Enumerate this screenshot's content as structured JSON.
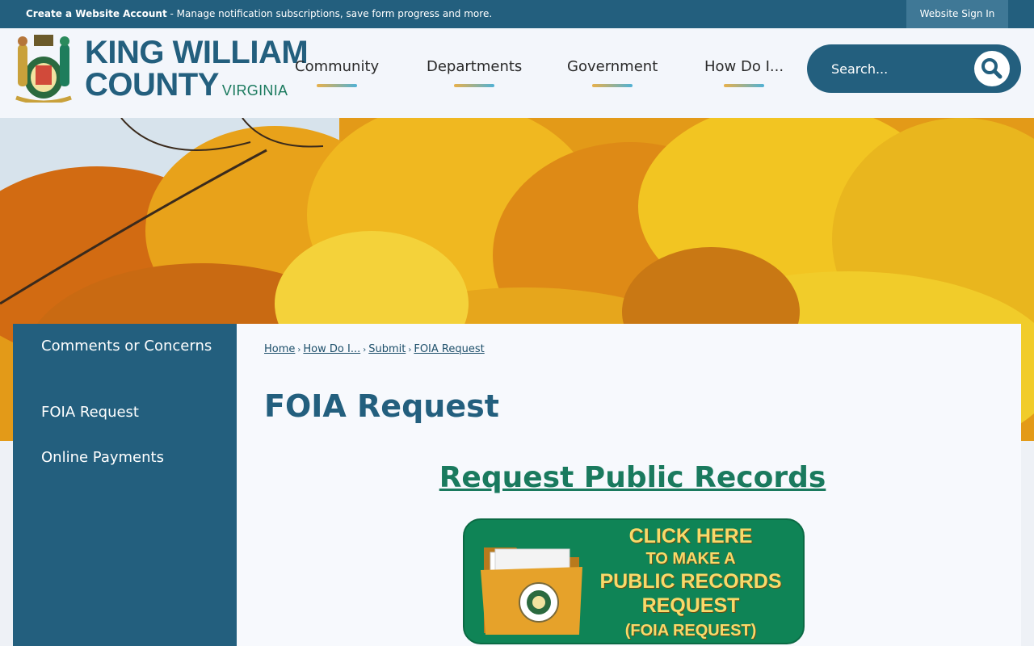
{
  "topbar": {
    "create_account": "Create a Website Account",
    "create_account_desc": " - Manage notification subscriptions, save form progress and more.",
    "sign_in": "Website Sign In"
  },
  "logo": {
    "line1": "KING WILLIAM",
    "line2": "COUNTY",
    "state": "VIRGINIA"
  },
  "nav": {
    "items": [
      {
        "label": "Community"
      },
      {
        "label": "Departments"
      },
      {
        "label": "Government"
      },
      {
        "label": "How Do I..."
      }
    ]
  },
  "search": {
    "placeholder": "Search..."
  },
  "sidebar": {
    "items": [
      {
        "label": "Comments or Concerns"
      },
      {
        "label": "FOIA Request"
      },
      {
        "label": "Online Payments"
      }
    ]
  },
  "breadcrumb": {
    "items": [
      "Home",
      "How Do I...",
      "Submit",
      "FOIA Request"
    ]
  },
  "main": {
    "title": "FOIA Request",
    "heading": "Request Public Records"
  },
  "banner": {
    "line1": "CLICK HERE",
    "line2": "TO MAKE A",
    "line3": "PUBLIC RECORDS",
    "line4": "REQUEST",
    "line5": "(FOIA REQUEST)"
  },
  "colors": {
    "primary": "#235f7e",
    "accent_green": "#1a7a5e",
    "banner_green": "#0f8456",
    "banner_text": "#f8d96a"
  },
  "icons": [
    "county-seal-icon",
    "search-icon",
    "folder-icon",
    "seal-icon"
  ]
}
